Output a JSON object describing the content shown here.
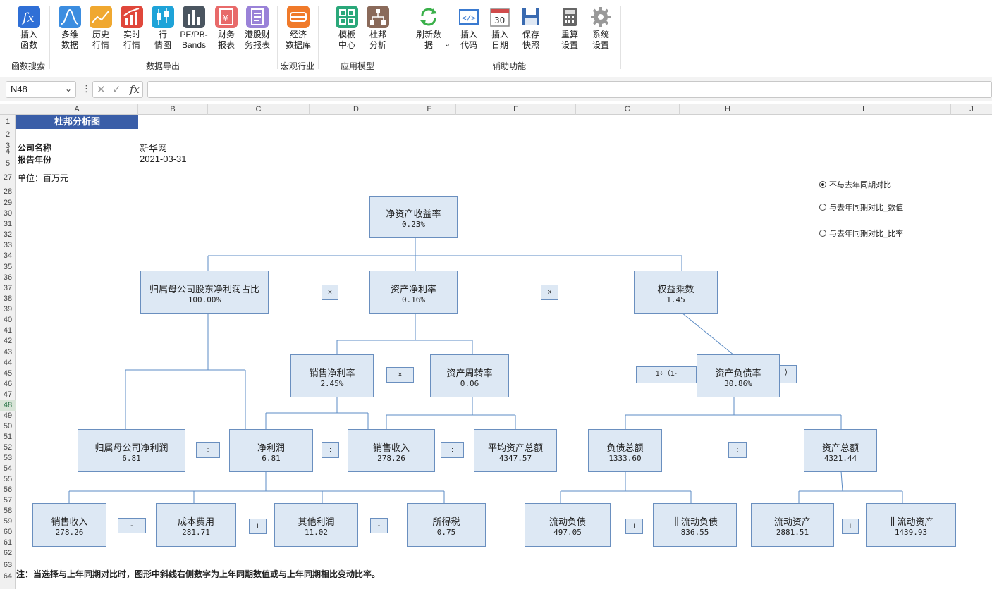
{
  "ribbon": {
    "buttons": [
      {
        "label": "插入\n函数",
        "icon": "fx-icon",
        "color": "#2f6fd6"
      },
      {
        "label": "多维\n数据",
        "icon": "bell-curve-icon",
        "color": "#3b8de0"
      },
      {
        "label": "历史\n行情",
        "icon": "line-trend-icon",
        "color": "#f0a830"
      },
      {
        "label": "实时\n行情",
        "icon": "bar-up-icon",
        "color": "#e0473b"
      },
      {
        "label": "行\n情图",
        "icon": "candlestick-icon",
        "color": "#1ea3d8"
      },
      {
        "label": "PE/PB-\nBands",
        "icon": "bar-chart-icon",
        "color": "#4a5560"
      },
      {
        "label": "财务\n报表",
        "icon": "finance-report-icon",
        "color": "#e86a6a"
      },
      {
        "label": "港股财\n务报表",
        "icon": "hk-report-icon",
        "color": "#9a82d8"
      },
      {
        "label": "经济\n数据库",
        "icon": "database-icon",
        "color": "#f07a2a"
      },
      {
        "label": "模板\n中心",
        "icon": "template-grid-icon",
        "color": "#2aa87a"
      },
      {
        "label": "杜邦\n分析",
        "icon": "org-chart-icon",
        "color": "#8a6a5a"
      },
      {
        "label": "刷新数\n据",
        "icon": "refresh-icon",
        "color": "#3ab04a"
      },
      {
        "label": "插入\n代码",
        "icon": "code-icon",
        "color": "#3a7ad0"
      },
      {
        "label": "插入\n日期",
        "icon": "calendar-icon",
        "color": "#d04a4a"
      },
      {
        "label": "保存\n快照",
        "icon": "save-icon",
        "color": "#3a6ab0"
      },
      {
        "label": "重算\n设置",
        "icon": "calculator-icon",
        "color": "#555"
      },
      {
        "label": "系统\n设置",
        "icon": "gear-icon",
        "color": "#888"
      }
    ],
    "groups": [
      "函数搜索",
      "数据导出",
      "宏观行业",
      "应用模型",
      "辅助功能"
    ],
    "refresh_dropdown": "⌄"
  },
  "formula_bar": {
    "name_box": "N48",
    "formula": ""
  },
  "columns": [
    "A",
    "B",
    "C",
    "D",
    "E",
    "F",
    "G",
    "H",
    "I",
    "J"
  ],
  "rows": [
    "1",
    "2",
    "3",
    "4",
    "5",
    "27",
    "28",
    "29",
    "30",
    "31",
    "32",
    "33",
    "34",
    "35",
    "36",
    "37",
    "38",
    "39",
    "40",
    "41",
    "42",
    "43",
    "44",
    "45",
    "46",
    "47",
    "48",
    "49",
    "50",
    "51",
    "52",
    "53",
    "54",
    "55",
    "56",
    "57",
    "58",
    "59",
    "60",
    "61",
    "62",
    "63",
    "64"
  ],
  "selected_row": "48",
  "sheet": {
    "title": "杜邦分析图",
    "company_label": "公司名称",
    "company_value": "新华网",
    "year_label": "报告年份",
    "year_value": "2021-03-31",
    "unit": "单位：百万元",
    "note": "注：当选择与上年同期对比时，图形中斜线右侧数字为上年同期数值或与上年同期相比变动比率。"
  },
  "options": [
    {
      "label": "不与去年同期对比",
      "checked": true
    },
    {
      "label": "与去年同期对比_数值",
      "checked": false
    },
    {
      "label": "与去年同期对比_比率",
      "checked": false
    }
  ],
  "dupont": {
    "roe": {
      "name": "净资产收益率",
      "value": "0.23%"
    },
    "parent_share": {
      "name": "归属母公司股东净利润占比",
      "value": "100.00%"
    },
    "roa": {
      "name": "资产净利率",
      "value": "0.16%"
    },
    "equity_mult": {
      "name": "权益乘数",
      "value": "1.45"
    },
    "net_margin": {
      "name": "销售净利率",
      "value": "2.45%"
    },
    "asset_turnover": {
      "name": "资产周转率",
      "value": "0.06"
    },
    "debt_ratio": {
      "name": "资产负债率",
      "value": "30.86%"
    },
    "debt_prefix": "1÷（1-",
    "debt_suffix": "）",
    "parent_profit": {
      "name": "归属母公司净利润",
      "value": "6.81"
    },
    "net_profit": {
      "name": "净利润",
      "value": "6.81"
    },
    "revenue1": {
      "name": "销售收入",
      "value": "278.26"
    },
    "avg_assets": {
      "name": "平均资产总额",
      "value": "4347.57"
    },
    "total_liab": {
      "name": "负债总额",
      "value": "1333.60"
    },
    "total_assets": {
      "name": "资产总额",
      "value": "4321.44"
    },
    "revenue2": {
      "name": "销售收入",
      "value": "278.26"
    },
    "cost": {
      "name": "成本费用",
      "value": "281.71"
    },
    "other_profit": {
      "name": "其他利润",
      "value": "11.02"
    },
    "tax": {
      "name": "所得税",
      "value": "0.75"
    },
    "cur_liab": {
      "name": "流动负债",
      "value": "497.05"
    },
    "noncur_liab": {
      "name": "非流动负债",
      "value": "836.55"
    },
    "cur_assets": {
      "name": "流动资产",
      "value": "2881.51"
    },
    "noncur_assets": {
      "name": "非流动资产",
      "value": "1439.93"
    },
    "ops": {
      "times": "×",
      "divide": "÷",
      "minus": "-",
      "plus": "+"
    }
  }
}
